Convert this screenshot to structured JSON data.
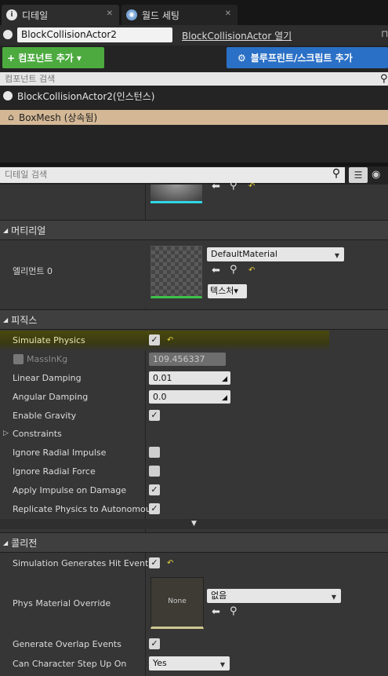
{
  "tabs": [
    {
      "label": "디테일",
      "icon": "info-icon"
    },
    {
      "label": "월드 세팅",
      "icon": "globe-icon"
    }
  ],
  "actor": {
    "name": "BlockCollisionActor2",
    "open_link": "BlockCollisionActor 열기"
  },
  "toolbar": {
    "add_component": "+ 컴포넌트 추가 ▾",
    "blueprint_button": "블루프린트/스크립트 추가"
  },
  "component_search": {
    "placeholder": "컴포넌트 검색"
  },
  "tree": {
    "root": "BlockCollisionActor2(인스턴스)",
    "selected": "BoxMesh (상속됨)"
  },
  "detail_search": {
    "placeholder": "디테일 검색"
  },
  "material_section": {
    "title": "머티리얼",
    "element_label": "엘리먼트 0",
    "material_value": "DefaultMaterial",
    "texture_button": "텍스처▾"
  },
  "physics_section": {
    "title": "피직스",
    "simulate_physics": "Simulate Physics",
    "mass_label": "MassInKg",
    "mass_value": "109.456337",
    "linear_damping_label": "Linear Damping",
    "linear_damping_value": "0.01",
    "angular_damping_label": "Angular Damping",
    "angular_damping_value": "0.0",
    "enable_gravity": "Enable Gravity",
    "constraints": "Constraints",
    "ignore_radial_impulse": "Ignore Radial Impulse",
    "ignore_radial_force": "Ignore Radial Force",
    "apply_impulse": "Apply Impulse on Damage",
    "replicate_physics": "Replicate Physics to Autonomous"
  },
  "collision_section": {
    "title": "콜리전",
    "sim_hit_events": "Simulation Generates Hit Events",
    "phys_material_label": "Phys Material Override",
    "phys_material_thumb": "None",
    "phys_material_value": "없음",
    "overlap_events": "Generate Overlap Events",
    "step_up_label": "Can Character Step Up On",
    "step_up_value": "Yes"
  },
  "colors": {
    "accent_green": "#4caa3f",
    "accent_blue": "#2a70c6",
    "selected_row": "#d4b896",
    "highlight": "#4a4a12"
  }
}
